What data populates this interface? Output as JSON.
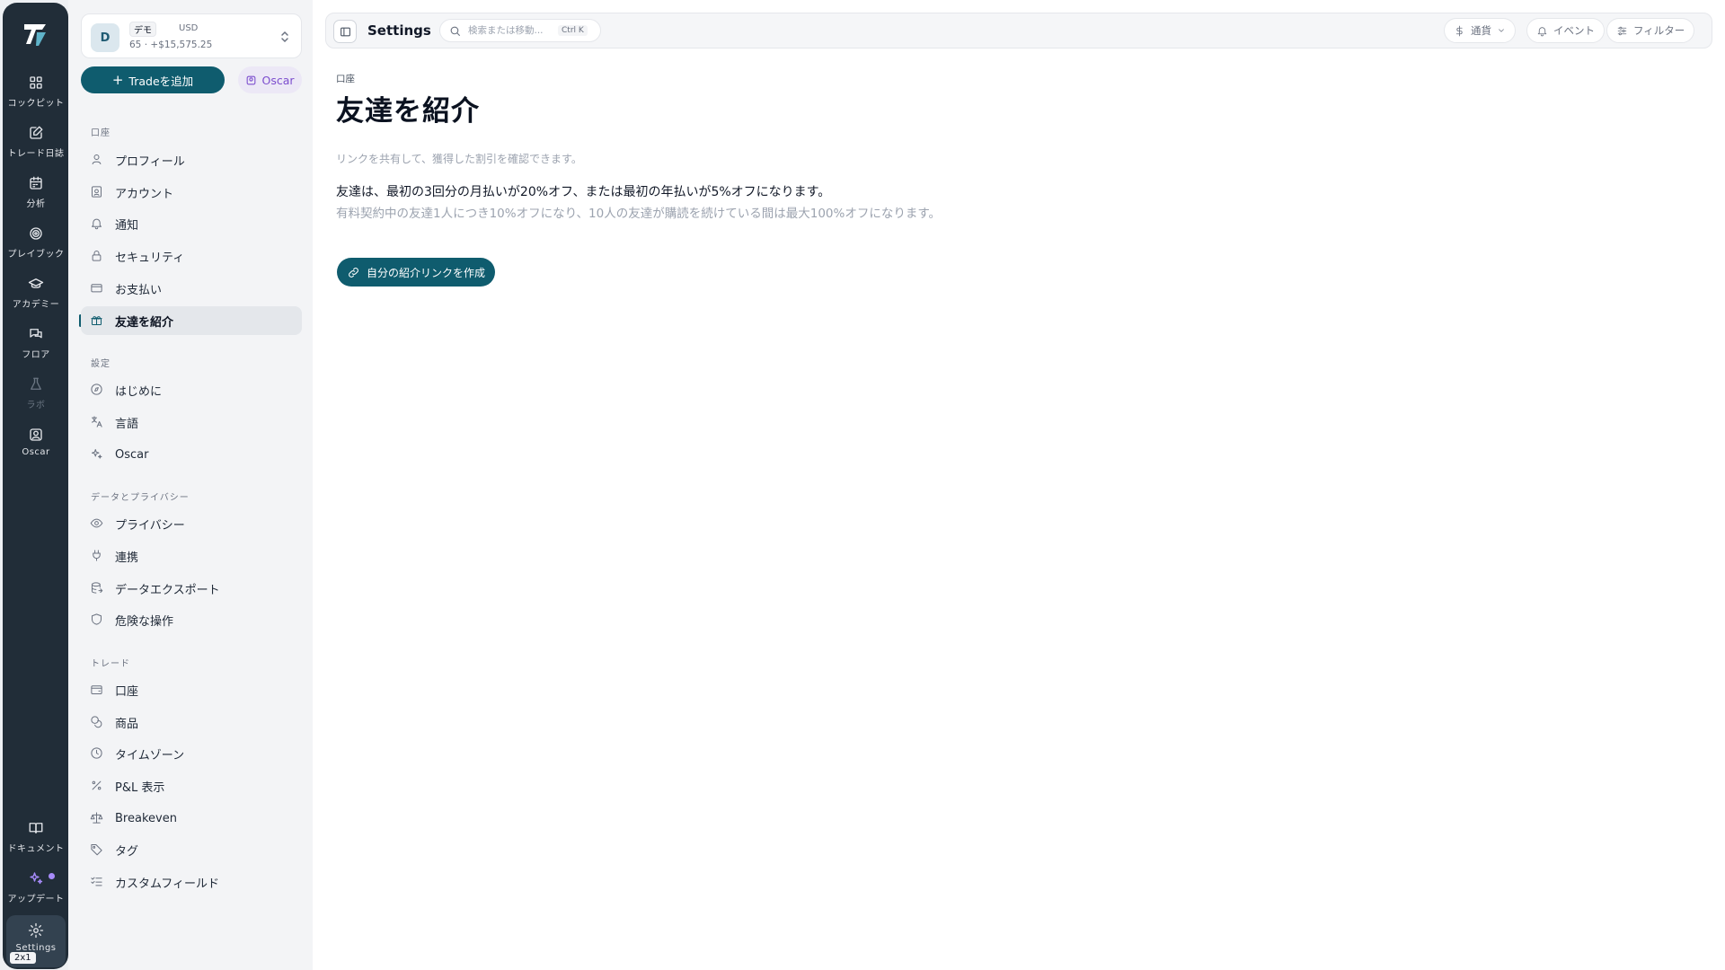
{
  "rail": {
    "items": [
      {
        "label": "コックピット",
        "icon": "grid-icon"
      },
      {
        "label": "トレード日誌",
        "icon": "journal-edit-icon"
      },
      {
        "label": "分析",
        "icon": "calendar-icon"
      },
      {
        "label": "プレイブック",
        "icon": "target-icon"
      },
      {
        "label": "アカデミー",
        "icon": "graduation-cap-icon"
      },
      {
        "label": "フロア",
        "icon": "chat-bubbles-icon"
      },
      {
        "label": "ラボ",
        "icon": "flask-icon"
      },
      {
        "label": "Oscar",
        "icon": "user-square-icon"
      },
      {
        "label": "ドキュメント",
        "icon": "book-icon"
      },
      {
        "label": "アップデート",
        "icon": "sparkles-icon"
      },
      {
        "label": "Settings",
        "icon": "gear-icon"
      }
    ],
    "zoom_badge": "2x1"
  },
  "account": {
    "avatar": "D",
    "tag": "デモ",
    "currency": "USD",
    "summary": "65 · +$15,575.25"
  },
  "buttons": {
    "add_trade": "Tradeを追加",
    "oscar": "Oscar"
  },
  "sidebar": {
    "section_account": "口座",
    "account_items": [
      "プロフィール",
      "アカウント",
      "通知",
      "セキュリティ",
      "お支払い",
      "友達を紹介"
    ],
    "section_settings": "設定",
    "settings_items": [
      "はじめに",
      "言語",
      "Oscar"
    ],
    "section_data": "データとプライバシー",
    "data_items": [
      "プライバシー",
      "連携",
      "データエクスポート",
      "危険な操作"
    ],
    "section_trade": "トレード",
    "trade_items": [
      "口座",
      "商品",
      "タイムゾーン",
      "P&L 表示",
      "Breakeven",
      "タグ",
      "カスタムフィールド"
    ]
  },
  "topbar": {
    "title": "Settings",
    "search_placeholder": "検索または移動...",
    "shortcut": "Ctrl K",
    "currency": "通貨",
    "events": "イベント",
    "filter": "フィルター"
  },
  "page": {
    "breadcrumb": "口座",
    "title": "友達を紹介",
    "description": "リンクを共有して、獲得した割引を確認できます。",
    "headline": "友達は、最初の3回分の月払いが20%オフ、または最初の年払いが5%オフになります。",
    "detail": "有料契約中の友達1人につき10%オフになり、10人の友達が購読を続けている間は最大100%オフになります。",
    "cta": "自分の紹介リンクを作成"
  },
  "colors": {
    "accent": "#0f5c6e",
    "rail_bg": "#212d38",
    "oscar_accent": "#7c4dce"
  }
}
